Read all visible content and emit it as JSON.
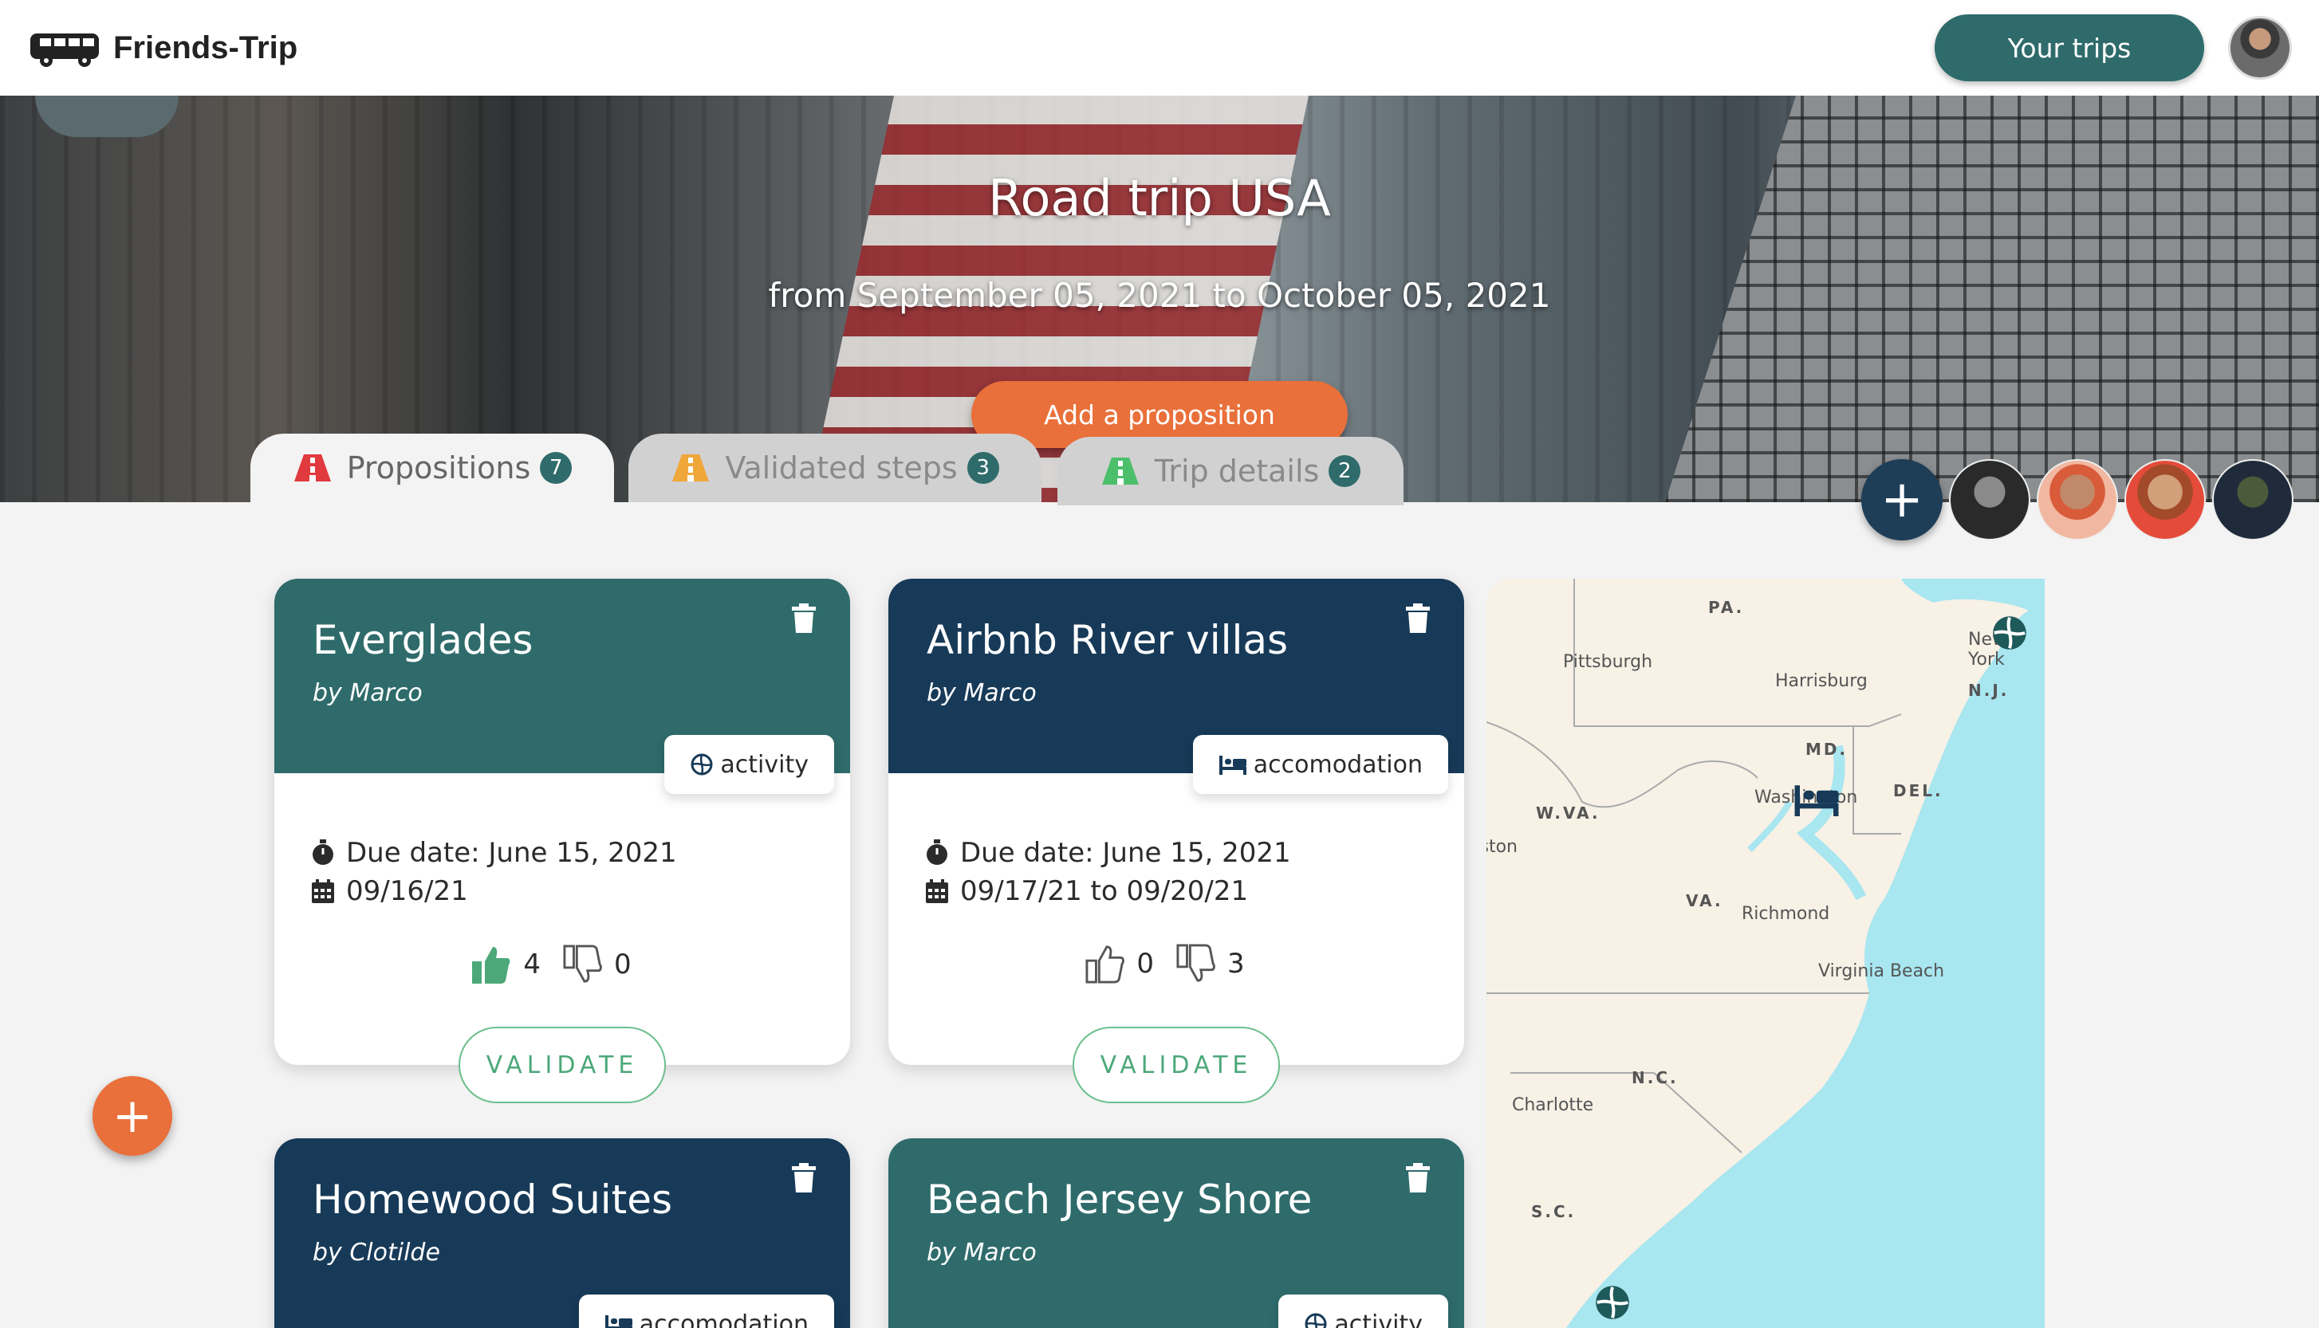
{
  "navbar": {
    "brand": "Friends-Trip",
    "your_trips_label": "Your trips"
  },
  "hero": {
    "title": "Road trip USA",
    "dates": "from September 05, 2021 to October 05, 2021",
    "add_proposition_label": "Add a proposition"
  },
  "tabs": [
    {
      "label": "Propositions",
      "count": "7",
      "icon_color": "#e0393e"
    },
    {
      "label": "Validated steps",
      "count": "3",
      "icon_color": "#f0a73a"
    },
    {
      "label": "Trip details",
      "count": "2",
      "icon_color": "#4cbf6a"
    }
  ],
  "members": {
    "add_label": "+"
  },
  "cards": [
    {
      "title": "Everglades",
      "author": "by Marco",
      "tag": "activity",
      "due": "Due date: June 15, 2021",
      "dates": "09/16/21",
      "likes": "4",
      "dislikes": "0",
      "validate_label": "VALIDATE"
    },
    {
      "title": "Airbnb River villas",
      "author": "by Marco",
      "tag": "accomodation",
      "due": "Due date: June 15, 2021",
      "dates": "09/17/21 to 09/20/21",
      "likes": "0",
      "dislikes": "3",
      "validate_label": "VALIDATE"
    },
    {
      "title": "Homewood Suites",
      "author": "by Clotilde",
      "tag": "accomodation"
    },
    {
      "title": "Beach Jersey Shore",
      "author": "by Marco",
      "tag": "activity"
    }
  ],
  "map": {
    "labels": [
      "Pittsburgh",
      "Harrisburg",
      "Washington",
      "Richmond",
      "Virginia Beach",
      "Charlotte",
      "New York",
      "Charleston"
    ],
    "states": [
      "PA.",
      "N.J.",
      "MD.",
      "DEL.",
      "W.VA.",
      "VA.",
      "N.C.",
      "S.C."
    ]
  },
  "fab_label": "+",
  "colors": {
    "teal": "#2f6b6b",
    "navy": "#173a58",
    "orange": "#e9703a",
    "validate_green": "#4ca879"
  }
}
